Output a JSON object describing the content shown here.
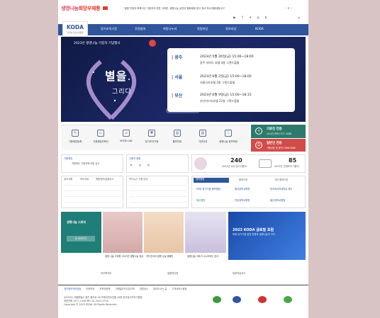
{
  "top": {
    "logo_prefix": "생명나눔",
    "logo_suffix": "희망우체통",
    "ticker": "\"생명 연장의 축복이신 기증자의 마쁜 고마운, 생명나눔 실천의 평화해에 맞고 정서 적서의해야합니다\"",
    "controls": "‹  ⏸  ›"
  },
  "brand": {
    "name": "KODA",
    "sub": "한국장기조직기증원"
  },
  "nav": {
    "items": [
      "장기조직기증",
      "후원참여",
      "희망나누리",
      "알림마당",
      "정보마당",
      "KODA"
    ],
    "menu_icon": "☰"
  },
  "hero": {
    "title": "2023년 생명나눔 기증자 기념행사",
    "big_text": "별을",
    "big_text2": "그리다",
    "events": [
      {
        "city": "광주",
        "when": "2023년 5월 26일(금) 15:00~18:00",
        "where": "광주 라마다 호텔 4층 그랜드볼룸"
      },
      {
        "city": "서울",
        "when": "2023년 6월 2일(금) 15:00~18:00",
        "where": "서울신라호텔 2층 그랜드볼룸"
      },
      {
        "city": "부산",
        "when": "2023년 6월 9일(금) 15:00~18:15",
        "where": "부산마스터호텔 22층 그랜드볼룸"
      }
    ]
  },
  "quick_links": [
    "기증희망등록",
    "기증희망자확인",
    "KODA LAB",
    "장기조직기증",
    "홍보자료",
    "기관안내",
    "생명나눔 정보마당"
  ],
  "contact": {
    "green_title": "의료진 전용",
    "green_sub": "24시간 연락 1577-1008",
    "red_title": "일반인 전용",
    "red_sub": "기증상담 및 문의 1588-0080"
  },
  "mid": {
    "left_a_title": "기증희망",
    "left_a_text": "지원하는 기증자에 대한 감사",
    "left_b_title": "기증자 현황",
    "tabs_left": [
      "공지사항",
      "보도자료",
      "채용정보/입찰공고"
    ],
    "tabs_mid": [
      "카드뉴스 기증 안내"
    ],
    "stats_title": "장기기증 희망 통계",
    "stats": [
      {
        "num": "240",
        "label": "2022년 뇌사 장기기증자"
      },
      {
        "num": "",
        "label": ""
      },
      {
        "num": "85",
        "label": "2022년 인체조직 기증자"
      }
    ],
    "partner_tabs": [
      "협력병원",
      "협약기관",
      "기타 협력기관"
    ],
    "partners": [
      "PMD 장기기증 협력병원",
      "중앙대학교병원",
      "한국외국어대학교 메디",
      "예수병원",
      "전남대학교병원",
      "울산대학교병원"
    ]
  },
  "gallery": {
    "store_title": "생명나눔 스토리",
    "store_btn": "더 보러가기",
    "captions": [
      "생명 나눔 주제를 2023년 생명나눔 영상",
      "5월 한국과 생명 나눔 캠페인",
      "생명나눔 이야기 나누어보는 감사",
      ""
    ],
    "banner_title": "2023 KODA 글로벌 포럼",
    "banner_sub": "미래 장기기증 발전 방향과 생명나눔의 가치"
  },
  "partners_bar": [
    "보건복지부",
    "질병관리청",
    "대한적십자사"
  ],
  "footer": {
    "links": [
      "개인정보처리방침",
      "이용약관",
      "저작권정책",
      "이메일무단수집거부",
      "경영공시",
      "찾아오시는 길",
      "고객서비스헌장"
    ],
    "address": "(04551) 서울특별시 중구 을지로 16 프레지던트호텔 19층 한국장기조직기증원",
    "phone": "대표전화 1577-1458  팩스 02-3447-5750",
    "copyright": "Copyright © 2023 KODA. All Rights Reserved."
  },
  "colors": {
    "nav": "#2f559d",
    "green": "#2d7a6d",
    "red": "#d14b48",
    "hero": "#14214f"
  }
}
